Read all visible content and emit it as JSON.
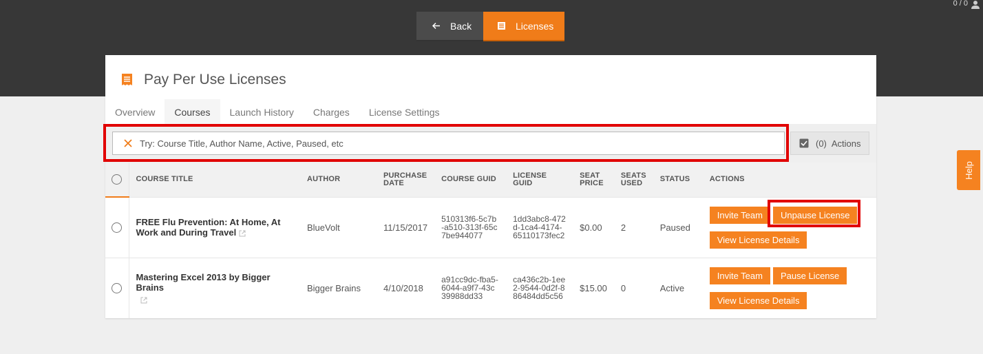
{
  "header": {
    "counter": "0 / 0",
    "nav": {
      "back_label": "Back",
      "licenses_label": "Licenses"
    }
  },
  "card": {
    "title": "Pay Per Use Licenses",
    "tabs": [
      "Overview",
      "Courses",
      "Launch History",
      "Charges",
      "License Settings"
    ],
    "active_tab": "Courses"
  },
  "search": {
    "value": "",
    "placeholder": "Try: Course Title, Author Name, Active, Paused, etc"
  },
  "actions_button": {
    "count": "(0)",
    "label": "Actions"
  },
  "table": {
    "headers": {
      "course_title": "COURSE TITLE",
      "author": "AUTHOR",
      "purchase_date_1": "PURCHASE",
      "purchase_date_2": "DATE",
      "course_guid": "COURSE GUID",
      "license_guid": "LICENSE GUID",
      "seat_price_1": "SEAT",
      "seat_price_2": "PRICE",
      "seats_used_1": "SEATS",
      "seats_used_2": "USED",
      "status": "STATUS",
      "actions": "ACTIONS"
    },
    "rows": [
      {
        "course_title": "FREE Flu Prevention: At Home, At Work and During Travel",
        "author": "BlueVolt",
        "purchase_date": "11/15/2017",
        "course_guid": "510313f6-5c7b-a510-313f-65c7be944077",
        "license_guid": "1dd3abc8-472d-1ca4-4174-65110173fec2",
        "seat_price": "$0.00",
        "seats_used": "2",
        "status": "Paused",
        "invite_label": "Invite Team",
        "toggle_label": "Unpause License",
        "details_label": "View License Details"
      },
      {
        "course_title": "Mastering Excel 2013 by Bigger Brains",
        "author": "Bigger Brains",
        "purchase_date": "4/10/2018",
        "course_guid": "a91cc9dc-fba5-6044-a9f7-43c39988dd33",
        "license_guid": "ca436c2b-1ee2-9544-0d2f-886484dd5c56",
        "seat_price": "$15.00",
        "seats_used": "0",
        "status": "Active",
        "invite_label": "Invite Team",
        "toggle_label": "Pause License",
        "details_label": "View License Details"
      }
    ]
  },
  "help": {
    "label": "Help"
  },
  "colors": {
    "accent": "#f58220",
    "highlight": "#e10000",
    "topbar": "#373737"
  }
}
